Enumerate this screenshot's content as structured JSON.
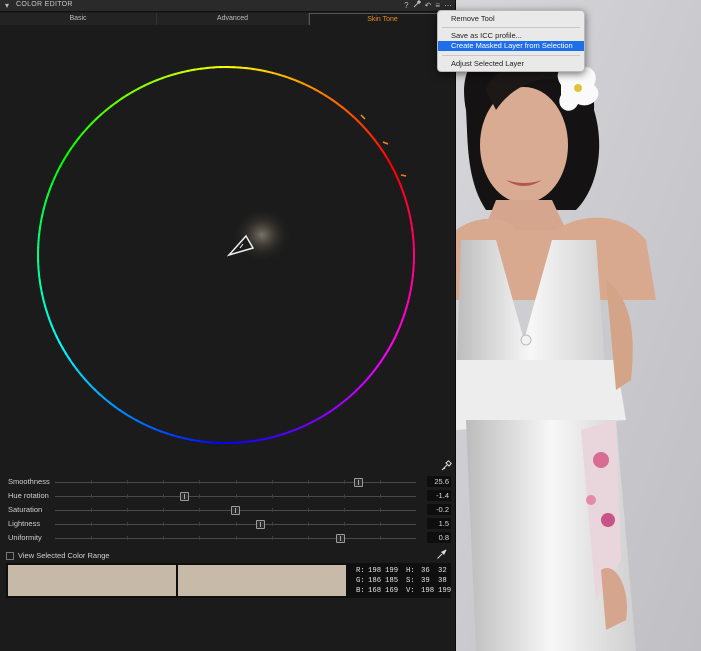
{
  "header": {
    "title": "COLOR EDITOR",
    "icons": [
      "help-icon",
      "pipette-icon",
      "undo-icon",
      "menu-icon",
      "more-icon"
    ],
    "help_glyph": "?",
    "undo_glyph": "↶",
    "menu_glyph": "≡",
    "more_glyph": "⋯",
    "pipette_glyph": "⟋"
  },
  "tabs": [
    {
      "label": "Basic",
      "active": false
    },
    {
      "label": "Advanced",
      "active": false
    },
    {
      "label": "Skin Tone",
      "active": true
    }
  ],
  "sliders": [
    {
      "label": "Smoothness",
      "value": "25.6",
      "position": 0.84
    },
    {
      "label": "Hue rotation",
      "value": "-1.4",
      "position": 0.36
    },
    {
      "label": "Saturation",
      "value": "-0.2",
      "position": 0.5
    },
    {
      "label": "Lightness",
      "value": "1.5",
      "position": 0.57
    },
    {
      "label": "Uniformity",
      "value": "0.8",
      "position": 0.79
    }
  ],
  "view_range": {
    "label": "View Selected Color Range",
    "checked": false
  },
  "swatches": {
    "color_before": "#c6b9a8",
    "color_after": "#c7baa9"
  },
  "readout": {
    "r": {
      "label": "R:",
      "v1": "198",
      "v2": "199"
    },
    "g": {
      "label": "G:",
      "v1": "186",
      "v2": "185"
    },
    "b": {
      "label": "B:",
      "v1": "168",
      "v2": "169"
    },
    "h": {
      "label": "H:",
      "v1": "36",
      "v2": "32"
    },
    "s": {
      "label": "S:",
      "v1": "39",
      "v2": "38"
    },
    "v": {
      "label": "V:",
      "v1": "198",
      "v2": "199"
    }
  },
  "menu": {
    "items": [
      {
        "label": "Remove Tool",
        "highlighted": false
      },
      {
        "label": "Save as ICC profile...",
        "highlighted": false
      },
      {
        "label": "Create Masked Layer from Selection",
        "highlighted": true
      },
      {
        "label": "Adjust Selected Layer",
        "highlighted": false
      }
    ]
  },
  "colors": {
    "accent": "#f28a1e",
    "menu_highlight": "#1d6ee8",
    "panel_bg": "#1b1b1b"
  }
}
